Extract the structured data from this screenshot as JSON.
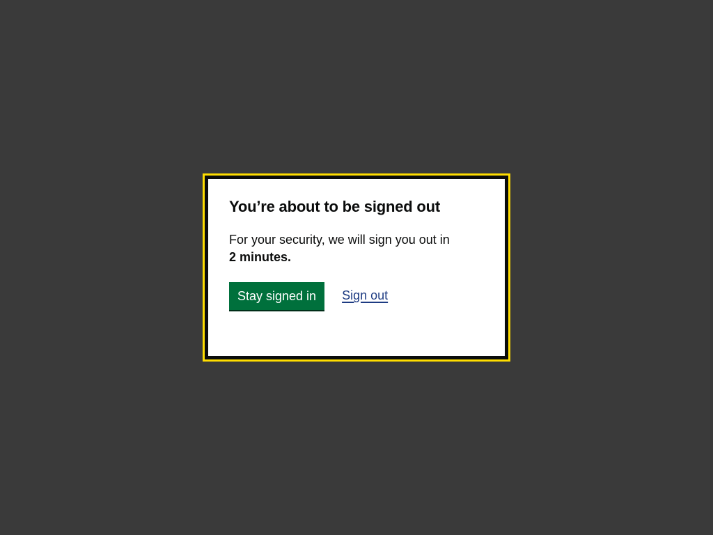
{
  "dialog": {
    "title": "You’re about to be signed out",
    "message": "For your security, we will sign you out in",
    "countdown": "2 minutes.",
    "stay_label": "Stay signed in",
    "signout_label": "Sign out"
  },
  "colors": {
    "overlay": "#3a3a3a",
    "focus": "#ffdd00",
    "dialog_border": "#0b0c0c",
    "primary_button": "#00703c",
    "link": "#1d3b82"
  }
}
